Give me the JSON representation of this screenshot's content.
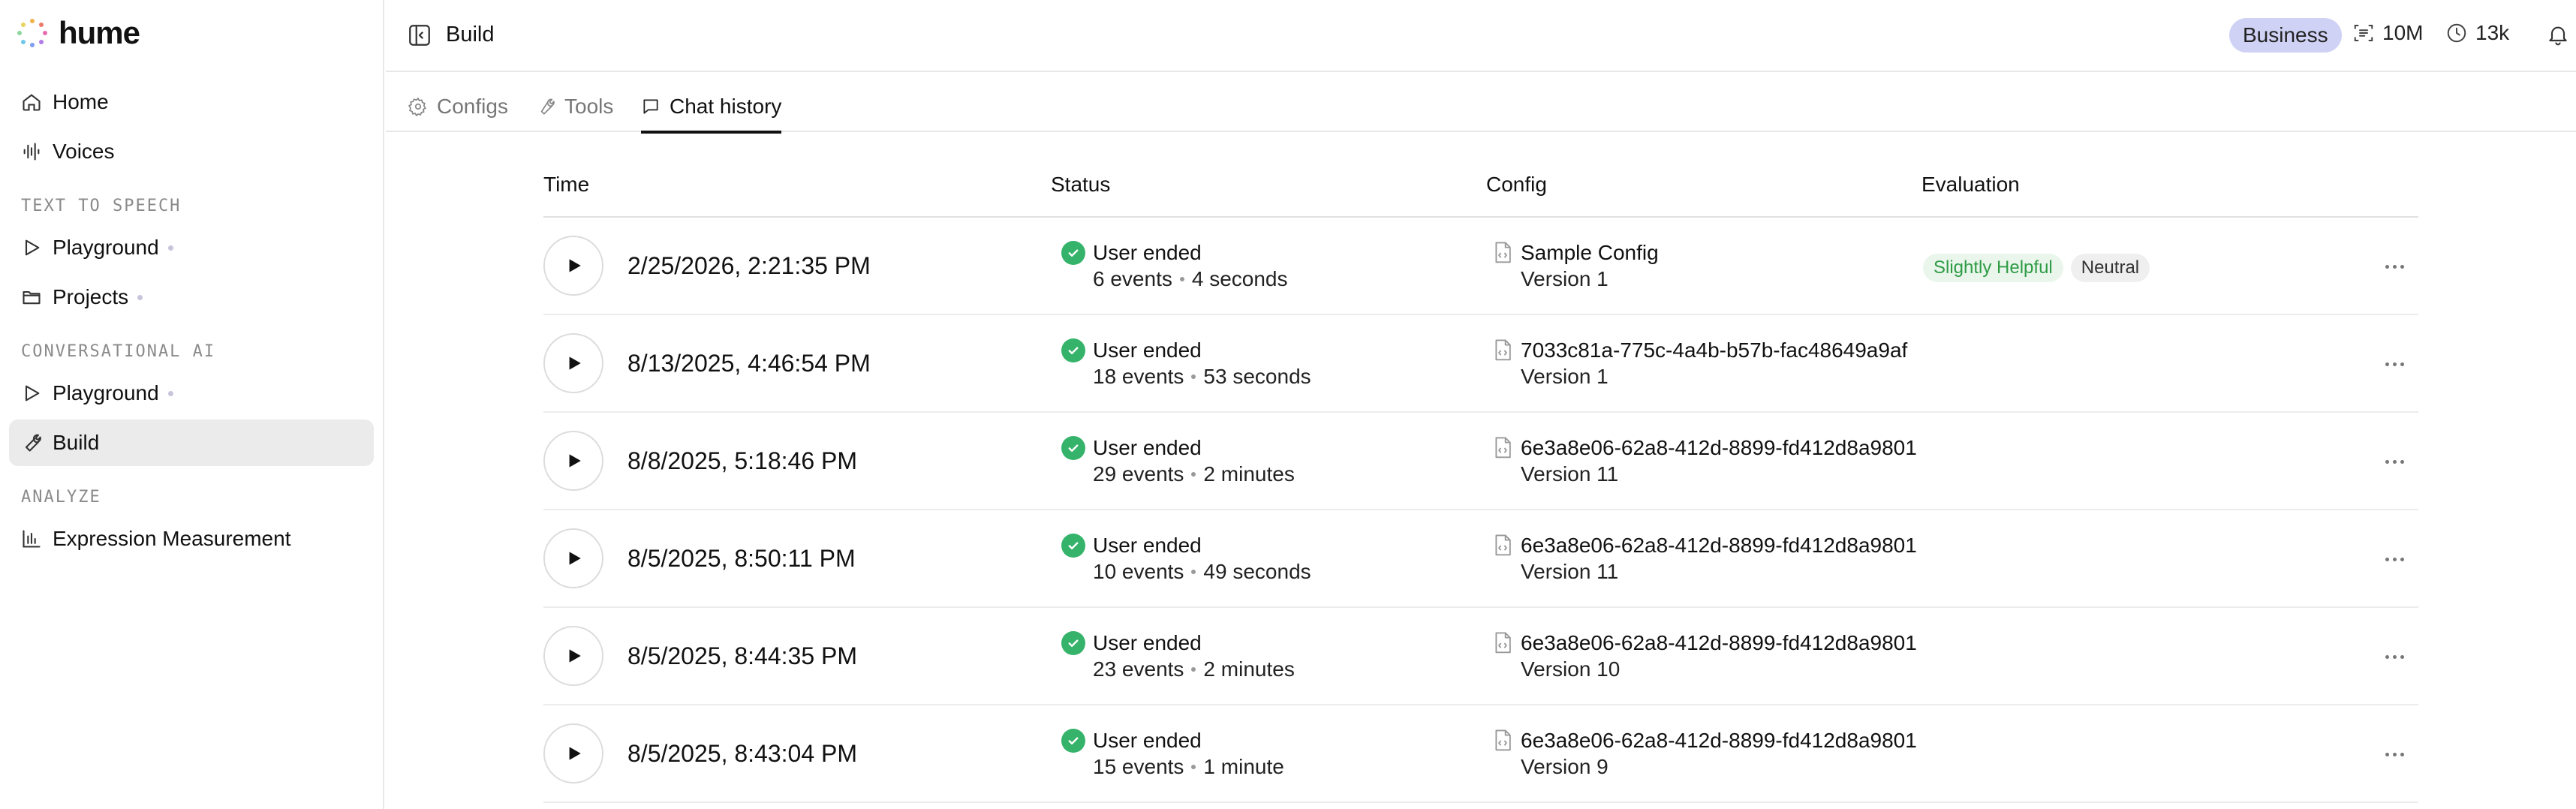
{
  "brand": {
    "name": "hume"
  },
  "sidebar": {
    "items_top": [
      {
        "label": "Home",
        "icon": "home-icon"
      },
      {
        "label": "Voices",
        "icon": "waveform-icon"
      }
    ],
    "section_tts": "TEXT TO SPEECH",
    "tts_items": [
      {
        "label": "Playground",
        "icon": "play-outline-icon"
      },
      {
        "label": "Projects",
        "icon": "folder-icon"
      }
    ],
    "section_conv": "CONVERSATIONAL AI",
    "conv_items": [
      {
        "label": "Playground",
        "icon": "play-outline-icon"
      },
      {
        "label": "Build",
        "icon": "wrench-icon"
      }
    ],
    "section_analyze": "ANALYZE",
    "analyze_items": [
      {
        "label": "Expression Measurement",
        "icon": "bar-chart-icon"
      }
    ]
  },
  "header": {
    "title": "Build",
    "plan": "Business",
    "stat_characters": "10M",
    "stat_minutes": "13k"
  },
  "tabs": [
    {
      "label": "Configs",
      "icon": "gear-icon"
    },
    {
      "label": "Tools",
      "icon": "wrench-icon"
    },
    {
      "label": "Chat history",
      "icon": "chat-icon"
    }
  ],
  "table": {
    "columns": {
      "time": "Time",
      "status": "Status",
      "config": "Config",
      "evaluation": "Evaluation"
    },
    "rows": [
      {
        "time": "2/25/2026, 2:21:35 PM",
        "status": "User ended",
        "events": "6 events",
        "duration": "4 seconds",
        "config": "Sample Config",
        "version": "Version 1",
        "tags": [
          "Slightly Helpful",
          "Neutral"
        ]
      },
      {
        "time": "8/13/2025, 4:46:54 PM",
        "status": "User ended",
        "events": "18 events",
        "duration": "53 seconds",
        "config": "7033c81a-775c-4a4b-b57b-fac48649a9af",
        "version": "Version 1"
      },
      {
        "time": "8/8/2025, 5:18:46 PM",
        "status": "User ended",
        "events": "29 events",
        "duration": "2 minutes",
        "config": "6e3a8e06-62a8-412d-8899-fd412d8a9801",
        "version": "Version 11"
      },
      {
        "time": "8/5/2025, 8:50:11 PM",
        "status": "User ended",
        "events": "10 events",
        "duration": "49 seconds",
        "config": "6e3a8e06-62a8-412d-8899-fd412d8a9801",
        "version": "Version 11"
      },
      {
        "time": "8/5/2025, 8:44:35 PM",
        "status": "User ended",
        "events": "23 events",
        "duration": "2 minutes",
        "config": "6e3a8e06-62a8-412d-8899-fd412d8a9801",
        "version": "Version 10"
      },
      {
        "time": "8/5/2025, 8:43:04 PM",
        "status": "User ended",
        "events": "15 events",
        "duration": "1 minute",
        "config": "6e3a8e06-62a8-412d-8899-fd412d8a9801",
        "version": "Version 9"
      }
    ]
  },
  "colors": {
    "accent_badge": "#cfd2f5",
    "success": "#35b36a",
    "helpful_text": "#2e9b45"
  }
}
